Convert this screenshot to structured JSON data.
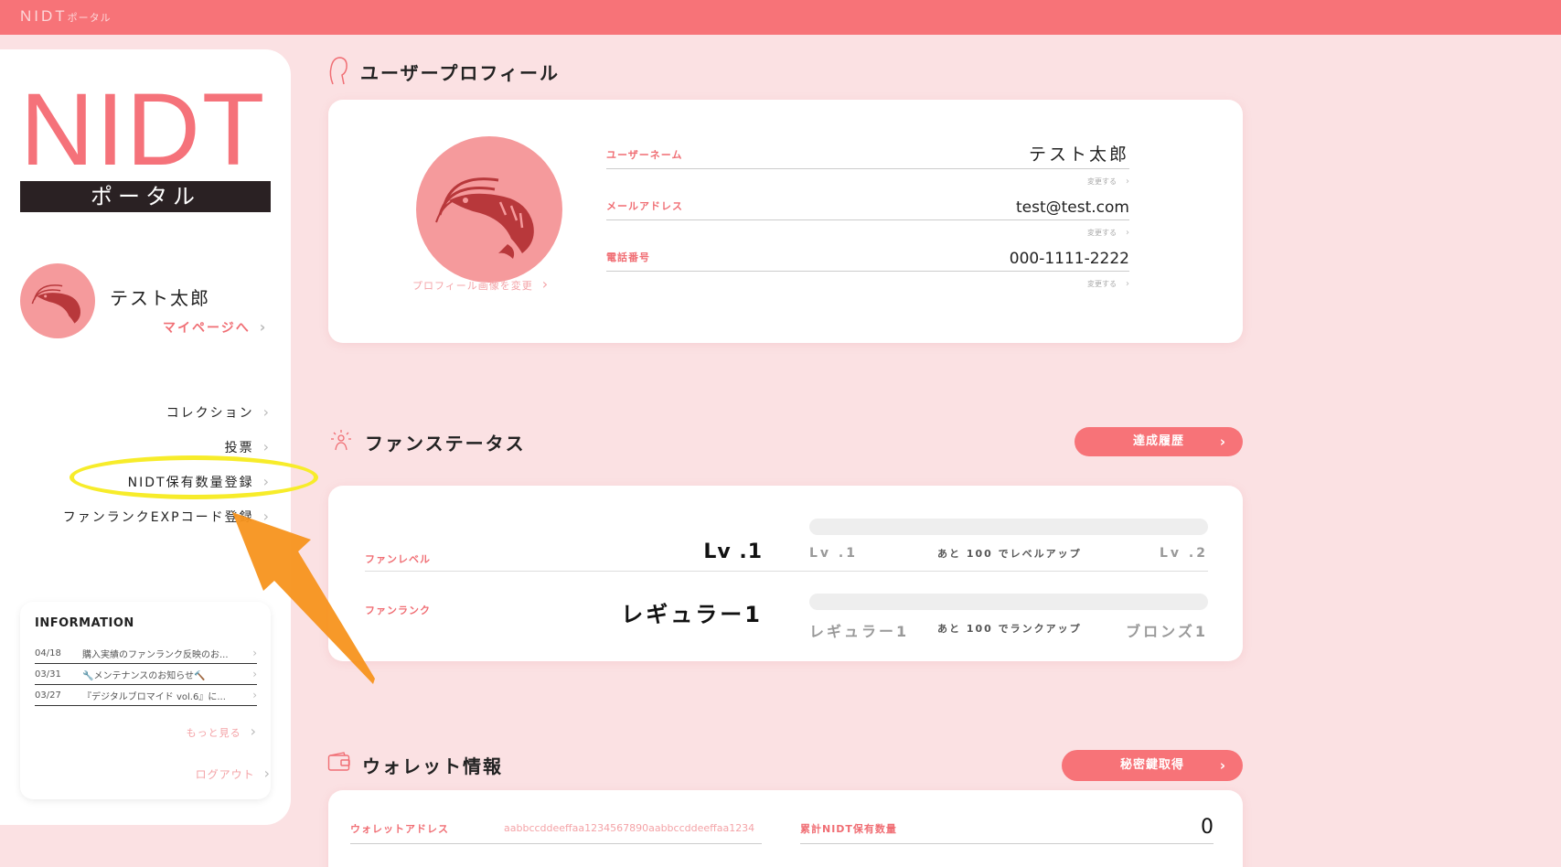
{
  "topbar": {
    "brand_main": "NIDT",
    "brand_sub": "ポータル"
  },
  "sidebar": {
    "logo_main": "NIDT",
    "logo_sub": "ポータル",
    "user_name": "テスト太郎",
    "mypage_label": "マイページへ",
    "nav_items": [
      {
        "label": "コレクション"
      },
      {
        "label": "投票"
      },
      {
        "label": "NIDT保有数量登録"
      },
      {
        "label": "ファンランクEXPコード登録"
      }
    ],
    "info": {
      "title": "INFORMATION",
      "items": [
        {
          "date": "04/18",
          "text": "購入実績のファンランク反映のお..."
        },
        {
          "date": "03/31",
          "text": "🔧メンテナンスのお知らせ🔨"
        },
        {
          "date": "03/27",
          "text": "『デジタルブロマイド vol.6』に..."
        }
      ],
      "more_label": "もっと見る"
    },
    "logout_label": "ログアウト"
  },
  "profile": {
    "title": "ユーザープロフィール",
    "change_image_label": "プロフィール画像を変更",
    "fields": [
      {
        "label": "ユーザーネーム",
        "value": "テスト太郎",
        "change": "変更する"
      },
      {
        "label": "メールアドレス",
        "value": "test@test.com",
        "change": "変更する"
      },
      {
        "label": "電話番号",
        "value": "000-1111-2222",
        "change": "変更する"
      }
    ]
  },
  "fan_status": {
    "title": "ファンステータス",
    "history_button": "達成履歴",
    "level": {
      "label": "ファンレベル",
      "value": "Lv .1",
      "from": "Lv .1",
      "to": "Lv .2",
      "note": "あと 100 でレベルアップ",
      "progress": 0
    },
    "rank": {
      "label": "ファンランク",
      "value": "レギュラー1",
      "from": "レギュラー1",
      "to": "ブロンズ1",
      "note": "あと 100 でランクアップ",
      "progress": 0
    }
  },
  "wallet": {
    "title": "ウォレット情報",
    "secret_button": "秘密鍵取得",
    "address_label": "ウォレットアドレス",
    "address_value": "aabbccddeeffaa1234567890aabbccddeeffaa1234",
    "total_label": "累計NIDT保有数量",
    "total_value": "0"
  },
  "colors": {
    "accent": "#f77378",
    "background": "#fbe1e3",
    "highlight": "#f7ec2a",
    "arrow": "#f7941d"
  }
}
